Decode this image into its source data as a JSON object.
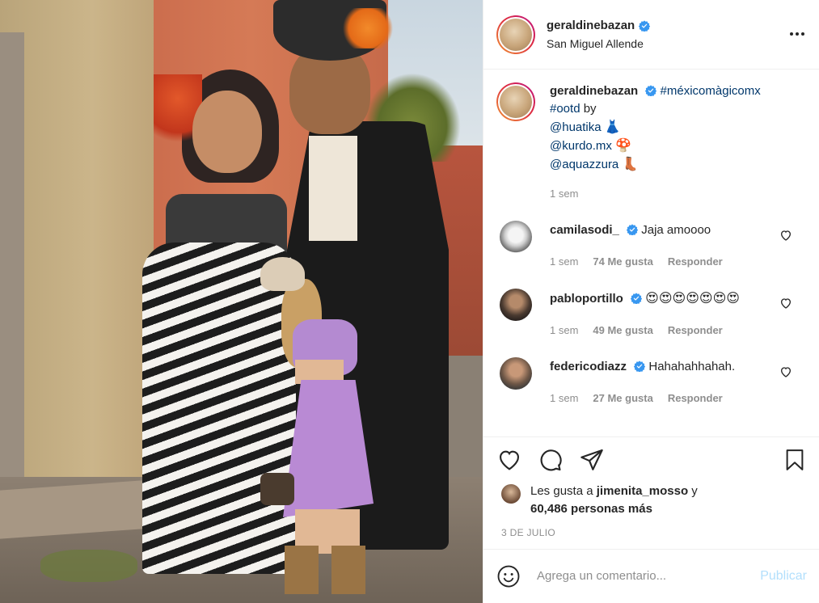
{
  "header": {
    "username": "geraldinebazan",
    "location": "San Miguel Allende",
    "verified_icon": "verified-badge-icon",
    "more_icon": "more-options-icon"
  },
  "caption": {
    "username": "geraldinebazan",
    "hashtag1": "#méxicomàgicomx",
    "hashtag2": "#ootd",
    "by_word": "by",
    "mention1": "@huatika",
    "mention1_emoji": "👗",
    "mention2": "@kurdo.mx",
    "mention2_emoji": "🍄",
    "mention3": "@aquazzura",
    "mention3_emoji": "👢",
    "time": "1 sem"
  },
  "comments": [
    {
      "username": "camilasodi_",
      "text": "Jaja amoooo",
      "time": "1 sem",
      "likes": "74 Me gusta",
      "reply": "Responder"
    },
    {
      "username": "pabloportillo",
      "text": "😍😍😍😍😍😍😍",
      "time": "1 sem",
      "likes": "49 Me gusta",
      "reply": "Responder"
    },
    {
      "username": "federicodiazz",
      "text": "Hahahahhahah.",
      "time": "1 sem",
      "likes": "27 Me gusta",
      "reply": "Responder"
    }
  ],
  "actions": {
    "like_icon": "heart-icon",
    "comment_icon": "comment-bubble-icon",
    "share_icon": "paper-plane-icon",
    "save_icon": "bookmark-icon"
  },
  "likes": {
    "prefix": "Les gusta a",
    "user": "jimenita_mosso",
    "connector": "y",
    "others": "60,486 personas más"
  },
  "date": "3 DE JULIO",
  "add_comment": {
    "placeholder": "Agrega un comentario...",
    "publish_label": "Publicar",
    "emoji_icon": "smiley-icon"
  },
  "colors": {
    "verified": "#3897f0",
    "link": "#00376b",
    "muted": "#8e8e8e",
    "publish_disabled": "#b2dffc"
  }
}
